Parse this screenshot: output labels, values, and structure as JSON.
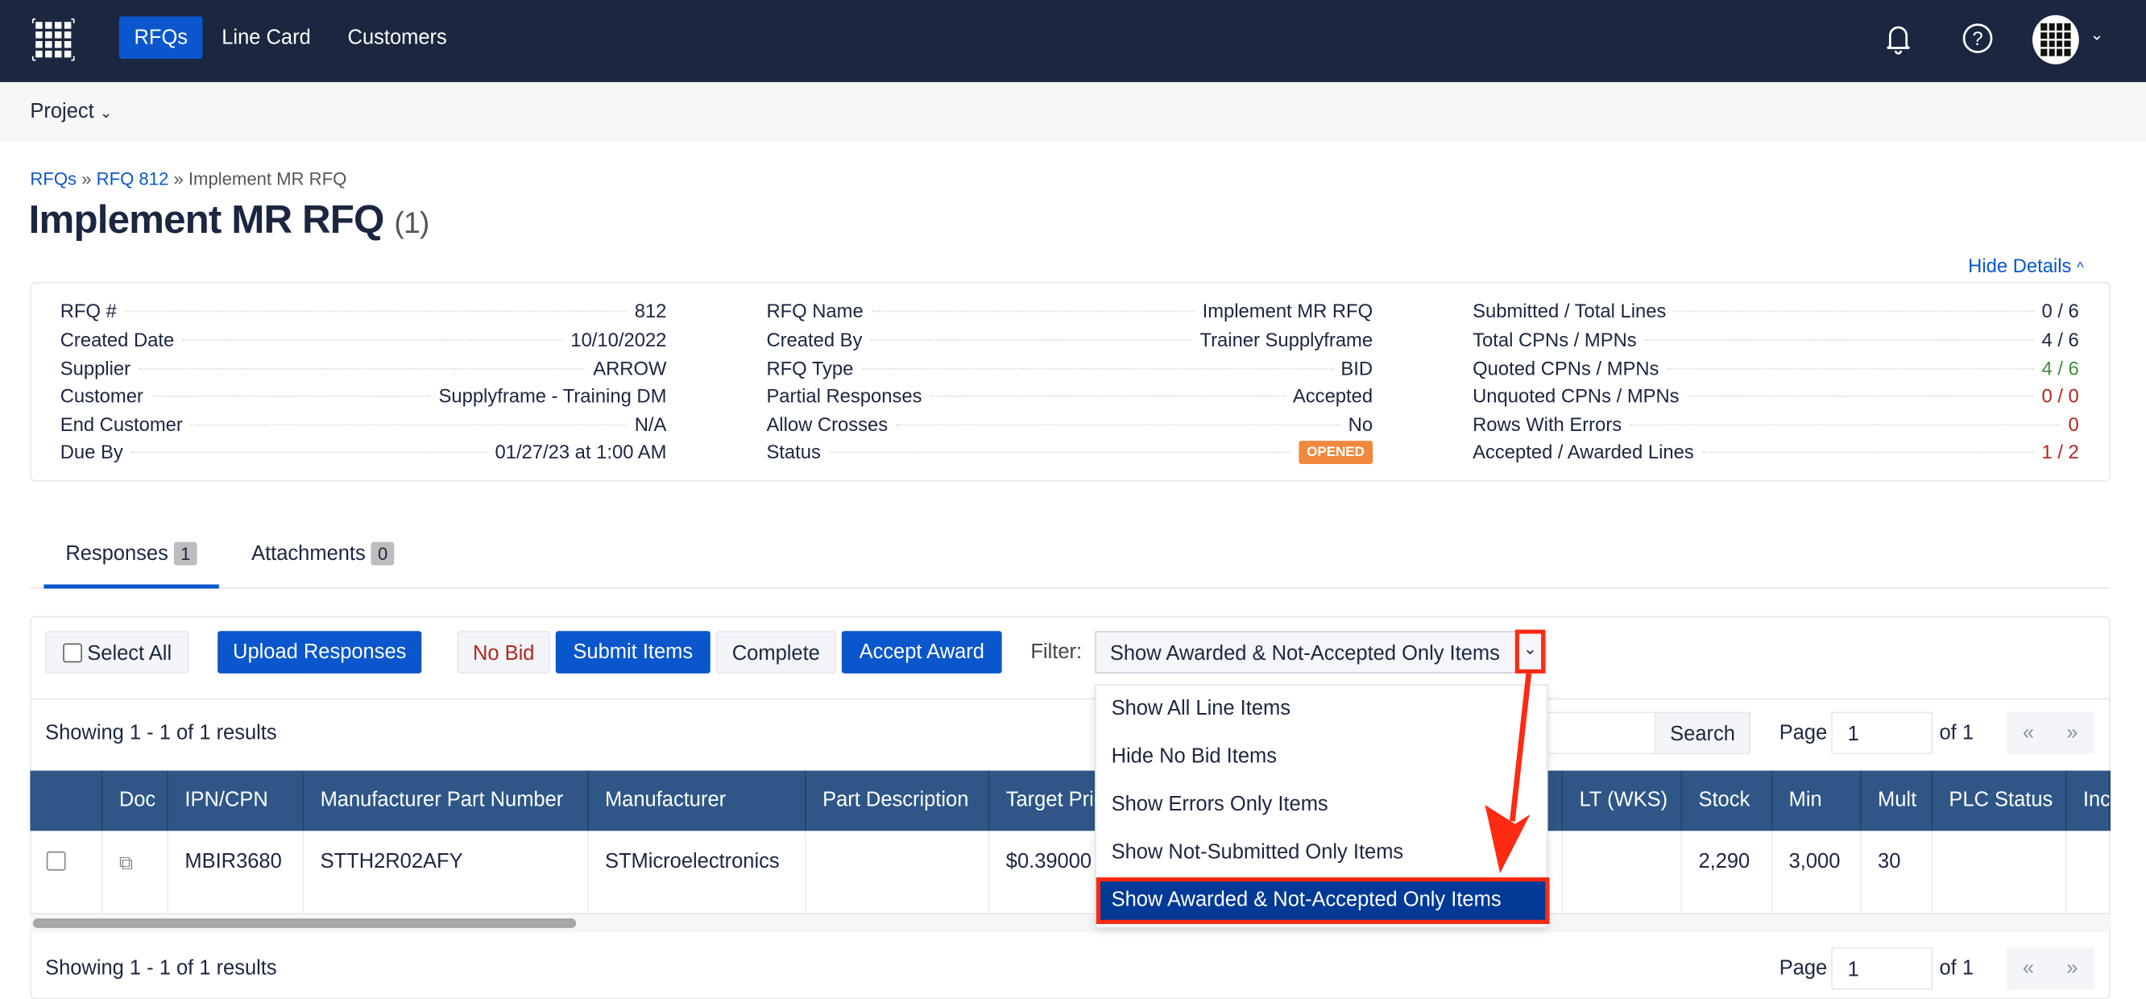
{
  "nav": {
    "items": [
      "RFQs",
      "Line Card",
      "Customers"
    ],
    "active": "RFQs"
  },
  "subnav": {
    "project": "Project"
  },
  "breadcrumb": {
    "items": [
      "RFQs",
      "RFQ 812"
    ],
    "current": "Implement MR RFQ",
    "sep": "»"
  },
  "title": {
    "text": "Implement MR RFQ",
    "count": "(1)"
  },
  "hide_details": "Hide Details",
  "details": {
    "col1": [
      {
        "label": "RFQ #",
        "value": "812"
      },
      {
        "label": "Created Date",
        "value": "10/10/2022"
      },
      {
        "label": "Supplier",
        "value": "ARROW"
      },
      {
        "label": "Customer",
        "value": "Supplyframe - Training DM"
      },
      {
        "label": "End Customer",
        "value": "N/A"
      },
      {
        "label": "Due By",
        "value": "01/27/23 at 1:00 AM"
      }
    ],
    "col2": [
      {
        "label": "RFQ Name",
        "value": "Implement MR RFQ"
      },
      {
        "label": "Created By",
        "value": "Trainer Supplyframe"
      },
      {
        "label": "RFQ Type",
        "value": "BID"
      },
      {
        "label": "Partial Responses",
        "value": "Accepted"
      },
      {
        "label": "Allow Crosses",
        "value": "No"
      },
      {
        "label": "Status",
        "value": "OPENED"
      }
    ],
    "col3": [
      {
        "label": "Submitted / Total Lines",
        "value": "0 / 6",
        "color": "#1b2640"
      },
      {
        "label": "Total CPNs / MPNs",
        "value": "4 / 6",
        "color": "#1b2640"
      },
      {
        "label": "Quoted CPNs / MPNs",
        "value": "4 / 6",
        "color": "#3f8a3a"
      },
      {
        "label": "Unquoted CPNs / MPNs",
        "value": "0 / 0",
        "color": "#b3261e"
      },
      {
        "label": "Rows With Errors",
        "value": "0",
        "color": "#b3261e"
      },
      {
        "label": "Accepted / Awarded Lines",
        "value": "1 / 2",
        "color": "#b3261e"
      }
    ]
  },
  "tabs": [
    {
      "label": "Responses",
      "count": "1"
    },
    {
      "label": "Attachments",
      "count": "0"
    }
  ],
  "toolbar": {
    "select_all": "Select All",
    "upload": "Upload Responses",
    "no_bid": "No Bid",
    "submit": "Submit Items",
    "complete": "Complete",
    "accept": "Accept Award",
    "filter_label": "Filter:",
    "filter_value": "Show Awarded & Not-Accepted Only Items"
  },
  "filter_options": [
    "Show All Line Items",
    "Hide No Bid Items",
    "Show Errors Only Items",
    "Show Not-Submitted Only Items",
    "Show Awarded & Not-Accepted Only Items"
  ],
  "results": {
    "showing": "Showing 1 - 1 of 1 results",
    "search": "Search",
    "page_label": "Page",
    "page": "1",
    "of": "of 1",
    "prev": "«",
    "next": "»"
  },
  "table": {
    "headers": [
      "Doc",
      "IPN/CPN",
      "Manufacturer Part Number",
      "Manufacturer",
      "Part Description",
      "Target Price",
      "LT (WKS)",
      "Stock",
      "Min",
      "Mult",
      "PLC Status",
      "Inc"
    ],
    "row": {
      "ipn": "MBIR3680",
      "mpn": "STTH2R02AFY",
      "manufacturer": "STMicroelectronics",
      "target": "$0.39000",
      "stock": "2,290",
      "min": "3,000",
      "mult": "30"
    }
  },
  "colors": {
    "nav": "#1b2640",
    "primary": "#0a56cc",
    "header": "#2f5687",
    "selected": "#003a96",
    "annotation": "#ff2a12",
    "status": "#f0883e"
  }
}
